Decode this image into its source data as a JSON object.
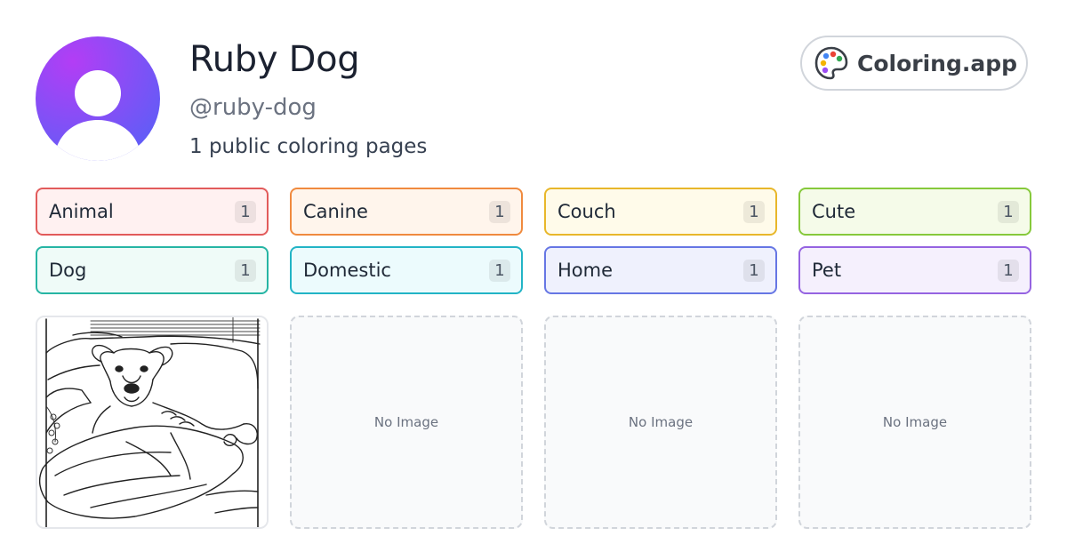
{
  "profile": {
    "name": "Ruby Dog",
    "handle": "@ruby-dog",
    "page_count_text": "1 public coloring pages"
  },
  "brand": {
    "label": "Coloring.app",
    "icon": "palette-icon"
  },
  "tags": [
    {
      "label": "Animal",
      "count": "1",
      "border": "#e25b5b",
      "bg": "#fff1f1"
    },
    {
      "label": "Canine",
      "count": "1",
      "border": "#f08a3e",
      "bg": "#fff5ec"
    },
    {
      "label": "Couch",
      "count": "1",
      "border": "#e8b72a",
      "bg": "#fffbea"
    },
    {
      "label": "Cute",
      "count": "1",
      "border": "#86c93b",
      "bg": "#f5fbe9"
    },
    {
      "label": "Dog",
      "count": "1",
      "border": "#26b5a4",
      "bg": "#effbf8"
    },
    {
      "label": "Domestic",
      "count": "1",
      "border": "#22b4c6",
      "bg": "#ecfbfd"
    },
    {
      "label": "Home",
      "count": "1",
      "border": "#6676e4",
      "bg": "#eff1fd"
    },
    {
      "label": "Pet",
      "count": "1",
      "border": "#9563e1",
      "bg": "#f5f0fd"
    }
  ],
  "gallery": {
    "image_alt": "dog on couch coloring page",
    "empty_label": "No Image"
  }
}
